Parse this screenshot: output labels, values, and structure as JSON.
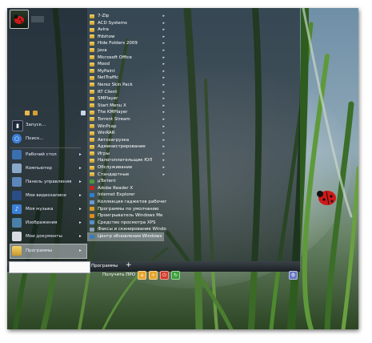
{
  "colors": {
    "accent_blue": "#3c7fd6",
    "sel_row": "#c6ccd2",
    "power": "#d43b2a",
    "sleep": "#e9a52c"
  },
  "left_panel": {
    "items": [
      {
        "label": "Запуск...",
        "icon": "run-icon"
      },
      {
        "label": "Поиск...",
        "icon": "search-icon"
      },
      {
        "label": "Рабочий стол",
        "icon": "desktop-icon"
      },
      {
        "label": "Компьютер",
        "icon": "computer-icon"
      },
      {
        "label": "Панель управления",
        "icon": "control-panel-icon"
      },
      {
        "label": "Мои видеозаписи",
        "icon": "video-icon"
      },
      {
        "label": "Моя музыка",
        "icon": "music-icon"
      },
      {
        "label": "Изображения",
        "icon": "pictures-icon"
      },
      {
        "label": "Мои документы",
        "icon": "documents-icon"
      },
      {
        "label": "Программы",
        "icon": "programs-icon"
      }
    ]
  },
  "programs": [
    {
      "label": "7-Zip",
      "folder": true
    },
    {
      "label": "ACD Systems",
      "folder": true
    },
    {
      "label": "Avira",
      "folder": true
    },
    {
      "label": "ffdshow",
      "folder": true
    },
    {
      "label": "Hide Folders 2009",
      "folder": true
    },
    {
      "label": "Java",
      "folder": true
    },
    {
      "label": "Microsoft Office",
      "folder": true
    },
    {
      "label": "Mood",
      "folder": true
    },
    {
      "label": "MyPaint",
      "folder": true
    },
    {
      "label": "NetTraffic",
      "folder": true
    },
    {
      "label": "Nerez Skin Pack",
      "folder": true
    },
    {
      "label": "RT Client",
      "folder": true
    },
    {
      "label": "SMPlayer",
      "folder": true
    },
    {
      "label": "Start Menu X",
      "folder": true
    },
    {
      "label": "The KMPlayer",
      "folder": true
    },
    {
      "label": "Torrent Stream",
      "folder": true
    },
    {
      "label": "WinPcap",
      "folder": true
    },
    {
      "label": "WinRAR",
      "folder": true
    },
    {
      "label": "Автозагрузка",
      "folder": true
    },
    {
      "label": "Администрирование",
      "folder": true
    },
    {
      "label": "Игры",
      "folder": true
    },
    {
      "label": "Налогоплательщик ЮЛ",
      "folder": true
    },
    {
      "label": "Обслуживание",
      "folder": true
    },
    {
      "label": "Стандартные",
      "folder": true
    },
    {
      "label": "µTorrent",
      "folder": false,
      "color": "#4a9a3a"
    },
    {
      "label": "Adobe Reader X",
      "folder": false,
      "color": "#c0281e"
    },
    {
      "label": "Internet Explorer",
      "folder": false,
      "color": "#2f7fd0"
    },
    {
      "label": "Коллекция гаджетов рабочег",
      "folder": false,
      "color": "#6a9ad0"
    },
    {
      "label": "Программы по умолчанию",
      "folder": false,
      "color": "#d99c2a"
    },
    {
      "label": "Проигрыватель Windows Me",
      "folder": false,
      "color": "#e08a20"
    },
    {
      "label": "Средство просмотра XPS",
      "folder": false,
      "color": "#5a8fc8"
    },
    {
      "label": "Факсы и сканирование Windo",
      "folder": false,
      "color": "#8aa0b8"
    },
    {
      "label": "Центр обновления Windows",
      "folder": false,
      "color": "#3a7ac0",
      "selected": true
    }
  ],
  "bottom": {
    "programs_label": "Программы",
    "plus_label": "+",
    "get_pro": "Получить ПРО",
    "search_value": ""
  }
}
